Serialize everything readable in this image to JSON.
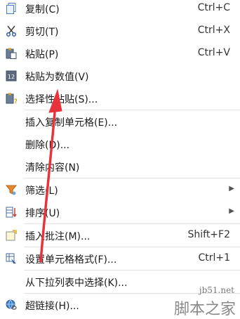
{
  "menu": {
    "items": [
      {
        "icon": "copy-icon",
        "label": "复制(C)",
        "shortcut": "Ctrl+C"
      },
      {
        "icon": "scissors-icon",
        "label": "剪切(T)",
        "shortcut": "Ctrl+X"
      },
      {
        "icon": "paste-icon",
        "label": "粘贴(P)",
        "shortcut": "Ctrl+V"
      },
      {
        "icon": "paste-values-icon",
        "label": "粘贴为数值(V)",
        "shortcut": "",
        "badge": "12"
      },
      {
        "icon": "paste-special-icon",
        "label": "选择性粘贴(S)...",
        "shortcut": ""
      },
      {
        "icon": "",
        "label": "插入复制单元格(E)...",
        "shortcut": ""
      },
      {
        "icon": "",
        "label": "删除(D)...",
        "shortcut": ""
      },
      {
        "icon": "",
        "label": "清除内容(N)",
        "shortcut": ""
      },
      {
        "icon": "filter-icon",
        "label": "筛选(L)",
        "shortcut": "",
        "submenu": true
      },
      {
        "icon": "sort-icon",
        "label": "排序(U)",
        "shortcut": "",
        "submenu": true
      },
      {
        "icon": "comment-icon",
        "label": "插入批注(M)...",
        "shortcut": "Shift+F2"
      },
      {
        "icon": "format-cells-icon",
        "label": "设置单元格格式(F)...",
        "shortcut": "Ctrl+1"
      },
      {
        "icon": "",
        "label": "从下拉列表中选择(K)...",
        "shortcut": ""
      },
      {
        "icon": "hyperlink-icon",
        "label": "超链接(H)...",
        "shortcut": ""
      }
    ]
  },
  "watermark": {
    "site": "jb51.net",
    "name": "脚本之家"
  },
  "colors": {
    "annotation_arrow": "#e8333a"
  }
}
